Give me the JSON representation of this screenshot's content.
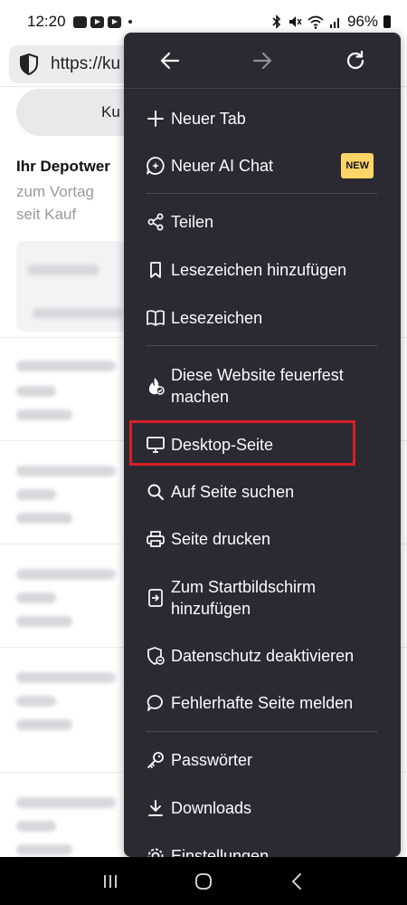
{
  "status_bar": {
    "time": "12:20",
    "battery": "96%"
  },
  "browser": {
    "url_text": "https://ku"
  },
  "background_page": {
    "kurs_button": "Ku",
    "depot_title": "Ihr Depotwer",
    "depot_sub_1": "zum Vortag",
    "depot_sub_2": "seit Kauf"
  },
  "menu": {
    "items": [
      {
        "label": "Neuer Tab",
        "icon": "plus-icon"
      },
      {
        "label": "Neuer AI Chat",
        "icon": "ai-chat-icon",
        "badge": "NEW"
      },
      {
        "label": "Teilen",
        "icon": "share-icon"
      },
      {
        "label": "Lesezeichen hinzufügen",
        "icon": "bookmark-add-icon"
      },
      {
        "label": "Lesezeichen",
        "icon": "bookmarks-icon"
      },
      {
        "label": "Diese Website feuerfest machen",
        "icon": "fireproof-icon"
      },
      {
        "label": "Desktop-Seite",
        "icon": "desktop-icon"
      },
      {
        "label": "Auf Seite suchen",
        "icon": "search-icon"
      },
      {
        "label": "Seite drucken",
        "icon": "print-icon"
      },
      {
        "label": "Zum Startbildschirm hinzufügen",
        "icon": "add-home-icon"
      },
      {
        "label": "Datenschutz deaktivieren",
        "icon": "privacy-shield-icon"
      },
      {
        "label": "Fehlerhafte Seite melden",
        "icon": "report-icon"
      },
      {
        "label": "Passwörter",
        "icon": "key-icon"
      },
      {
        "label": "Downloads",
        "icon": "download-icon"
      },
      {
        "label": "Einstellungen",
        "icon": "settings-icon"
      }
    ]
  },
  "colors": {
    "menu_bg": "#2b2a33",
    "highlight": "#d62027",
    "badge": "#ffd567"
  }
}
